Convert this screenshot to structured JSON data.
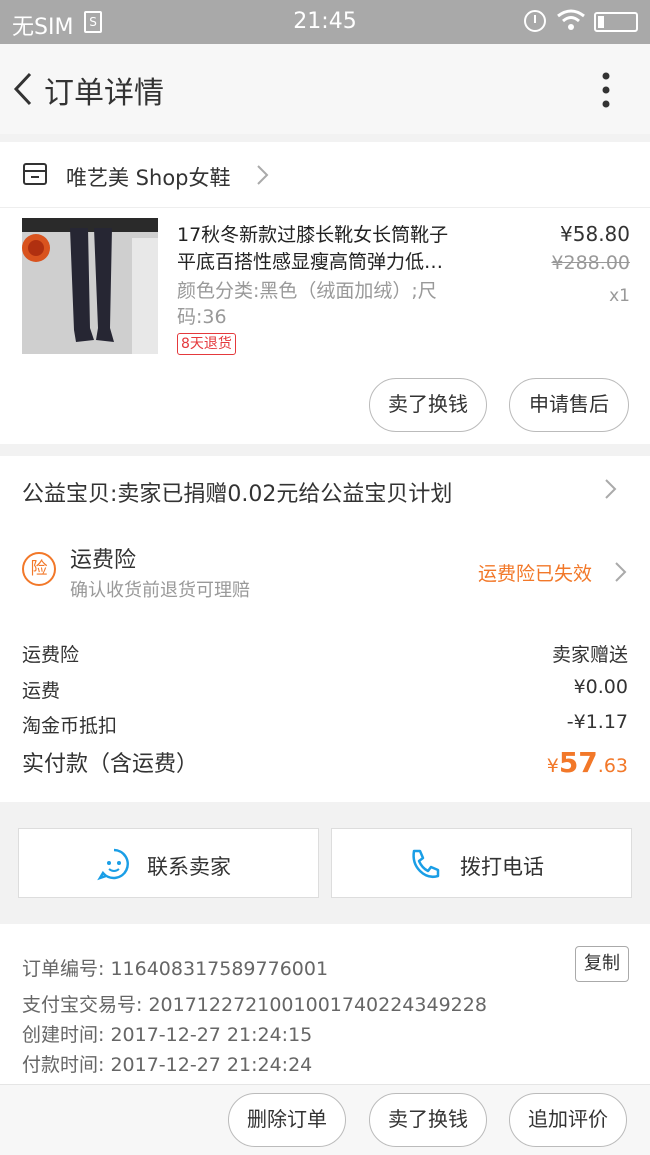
{
  "status_bar": {
    "carrier": "无SIM",
    "sim_icon": "S",
    "time": "21:45"
  },
  "nav": {
    "title": "订单详情"
  },
  "shop": {
    "name": "唯艺美 Shop女鞋"
  },
  "product": {
    "title_line1": "17秋冬新款过膝长靴女长筒靴子",
    "title_line2": "平底百搭性感显瘦高筒弹力低…",
    "sku_line1": "颜色分类:黑色（绒面加绒）;尺",
    "sku_line2": "码:36",
    "badge": "8天退货",
    "price": "¥58.80",
    "original_price": "¥288.00",
    "quantity": "x1"
  },
  "product_actions": {
    "resell": "卖了换钱",
    "after_sale": "申请售后"
  },
  "charity": {
    "text": "公益宝贝:卖家已捐赠0.02元给公益宝贝计划"
  },
  "insurance": {
    "icon_text": "险",
    "title": "运费险",
    "subtitle": "确认收货前退货可理赔",
    "status": "运费险已失效"
  },
  "fees": [
    {
      "label": "运费险",
      "value": "卖家赠送"
    },
    {
      "label": "运费",
      "value": "¥0.00"
    },
    {
      "label": "淘金币抵扣",
      "value": "-¥1.17"
    }
  ],
  "total": {
    "label": "实付款（含运费）",
    "currency": "¥",
    "integer": "57",
    "decimal": ".63"
  },
  "contact": {
    "seller": "联系卖家",
    "phone": "拨打电话"
  },
  "order_info": {
    "order_no_label": "订单编号:",
    "order_no": "116408317589776001",
    "copy": "复制",
    "alipay_label": "支付宝交易号:",
    "alipay_no": "2017122721001001740224349228",
    "created_label": "创建时间:",
    "created": "2017-12-27 21:24:15",
    "paid_label": "付款时间:",
    "paid": "2017-12-27 21:24:24"
  },
  "bottom_actions": {
    "delete": "删除订单",
    "resell": "卖了换钱",
    "review": "追加评价"
  },
  "colors": {
    "accent_orange": "#f27829",
    "badge_red": "#e4393c",
    "link_blue": "#1a9ee6"
  }
}
